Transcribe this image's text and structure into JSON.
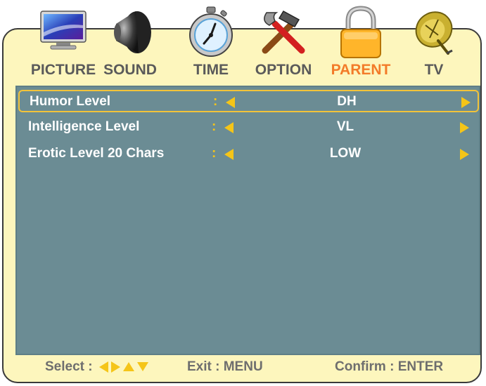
{
  "menu": {
    "tabs": [
      {
        "label": "PICTURE",
        "icon": "monitor-icon",
        "active": false
      },
      {
        "label": "SOUND",
        "icon": "speaker-icon",
        "active": false
      },
      {
        "label": "TIME",
        "icon": "stopwatch-icon",
        "active": false
      },
      {
        "label": "OPTION",
        "icon": "tools-icon",
        "active": false
      },
      {
        "label": "PARENT",
        "icon": "padlock-icon",
        "active": true
      },
      {
        "label": "TV",
        "icon": "satellite-dish-icon",
        "active": false
      }
    ],
    "active_tab_color": "#f37b29",
    "inactive_tab_color": "#5a5a5a"
  },
  "settings": {
    "rows": [
      {
        "name": "Humor Level",
        "separator": ":",
        "value": "DH",
        "selected": true
      },
      {
        "name": "Intelligence Level",
        "separator": ":",
        "value": "VL",
        "selected": false
      },
      {
        "name": "Erotic Level 20 Chars",
        "separator": ":",
        "value": "LOW",
        "selected": false
      }
    ],
    "panel_color": "#6b8c94",
    "highlight_color": "#f2c33a",
    "arrow_color": "#f5c518"
  },
  "footer": {
    "select_label": "Select :",
    "exit_label": "Exit : MENU",
    "confirm_label": "Confirm : ENTER"
  },
  "frame_color": "#fdf6bd"
}
